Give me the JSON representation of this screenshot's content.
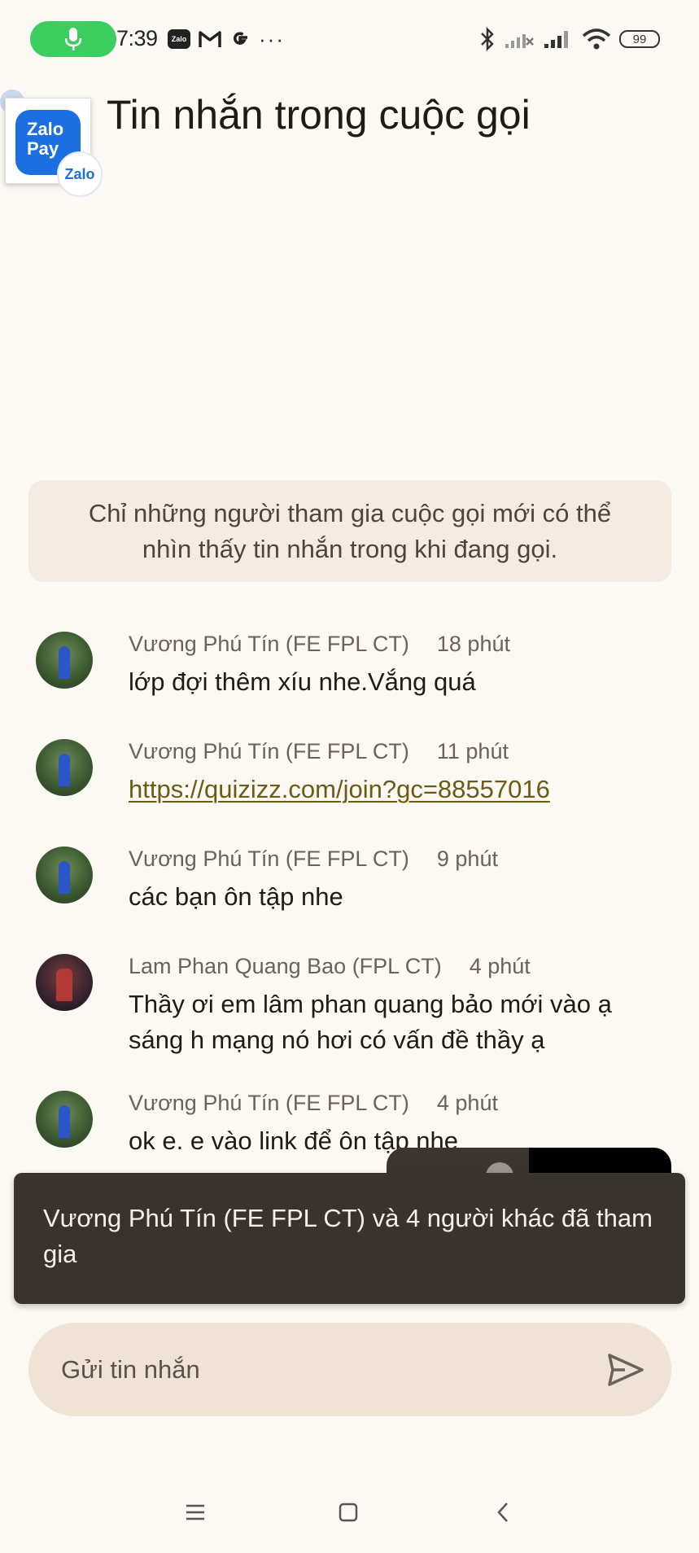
{
  "status_bar": {
    "time": "7:39",
    "notif_icons": [
      "microphone-icon",
      "zalo-icon",
      "gmail-icon",
      "google-icon",
      "more-dots-icon"
    ],
    "sys_icons": [
      "bluetooth-icon",
      "signal-off-icon",
      "signal-icon",
      "wifi-icon",
      "battery-icon"
    ],
    "battery": "99",
    "zalo_mini_label": "Zalo",
    "more_label": "···"
  },
  "header": {
    "title": "Tin nhắn trong cuộc gọi",
    "app_logo_text": "Zalo Pay",
    "app_badge_text": "Zalo"
  },
  "notice": "Chỉ những người tham gia cuộc gọi mới có thể nhìn thấy tin nhắn trong khi đang gọi.",
  "messages": [
    {
      "sender": "Vương Phú Tín (FE FPL CT)",
      "time": "18 phút",
      "text": "lớp đợi thêm xíu nhe.Vắng quá"
    },
    {
      "sender": "Vương Phú Tín (FE FPL CT)",
      "time": "11 phút",
      "text": "https://quizizz.com/join?gc=88557016"
    },
    {
      "sender": "Vương Phú Tín (FE FPL CT)",
      "time": "9 phút",
      "text": "các bạn ôn tập nhe"
    },
    {
      "sender": "Lam Phan Quang Bao (FPL CT)",
      "time": "4 phút",
      "text": "Thầy ơi em lâm phan quang bảo mới vào ạ sáng h mạng nó hơi có vấn đề thầy ạ"
    },
    {
      "sender": "Vương Phú Tín (FE FPL CT)",
      "time": "4 phút",
      "text": "ok e. e vào link để ôn tập nhe"
    }
  ],
  "snackbar": "Vương Phú Tín (FE FPL CT) và 4 người khác đã tham gia",
  "composer": {
    "placeholder": "Gửi tin nhắn",
    "value": ""
  },
  "nav": [
    "menu-icon",
    "home-icon",
    "back-icon"
  ],
  "colors": {
    "background": "#fcf8f3",
    "notice_bg": "#f4ebe2",
    "snackbar_bg": "#38332c",
    "composer_bg": "#efe3d6",
    "link": "#6d5a14",
    "mic_pill": "#3bce5f"
  }
}
